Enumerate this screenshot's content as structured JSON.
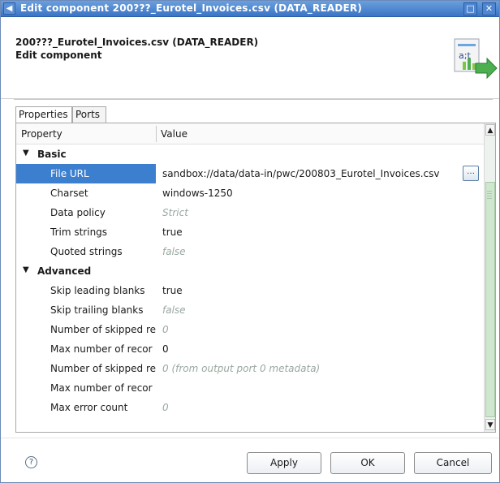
{
  "window": {
    "title": "Edit component 200???_Eurotel_Invoices.csv (DATA_READER)",
    "app_icon": "eclipse-back-icon",
    "maximize_icon": "maximize-icon",
    "close_icon": "close-icon"
  },
  "header": {
    "component_name": "200???_Eurotel_Invoices.csv (DATA_READER)",
    "subtitle": "Edit component",
    "icon": "data-reader-icon"
  },
  "tabs": [
    {
      "label": "Properties",
      "active": true
    },
    {
      "label": "Ports",
      "active": false
    }
  ],
  "table": {
    "col_property": "Property",
    "col_value": "Value",
    "rows": [
      {
        "kind": "category",
        "label": "Basic"
      },
      {
        "kind": "property",
        "label": "File URL",
        "value": "sandbox://data/data-in/pwc/200803_Eurotel_Invoices.csv",
        "selected": true,
        "muted": false
      },
      {
        "kind": "property",
        "label": "Charset",
        "value": "windows-1250",
        "muted": false
      },
      {
        "kind": "property",
        "label": "Data policy",
        "value": "Strict",
        "muted": true
      },
      {
        "kind": "property",
        "label": "Trim strings",
        "value": "true",
        "muted": false
      },
      {
        "kind": "property",
        "label": "Quoted strings",
        "value": "false",
        "muted": true
      },
      {
        "kind": "category",
        "label": "Advanced"
      },
      {
        "kind": "property",
        "label": "Skip leading blanks",
        "value": "true",
        "muted": false
      },
      {
        "kind": "property",
        "label": "Skip trailing blanks",
        "value": "false",
        "muted": true
      },
      {
        "kind": "property",
        "label": "Number of skipped re",
        "value": "0",
        "muted": true
      },
      {
        "kind": "property",
        "label": "Max number of recor",
        "value": "0",
        "muted": false
      },
      {
        "kind": "property",
        "label": "Number of skipped re",
        "value": "0 (from output port 0 metadata)",
        "muted": true
      },
      {
        "kind": "property",
        "label": "Max number of recor",
        "value": "",
        "muted": false
      },
      {
        "kind": "property",
        "label": "Max error count",
        "value": "0",
        "muted": true
      }
    ]
  },
  "buttons": {
    "apply": "Apply",
    "ok": "OK",
    "cancel": "Cancel",
    "help_icon": "help-icon"
  },
  "colors": {
    "titlebar": "#3b74c4",
    "selection": "#3d7fcf",
    "scroll_thumb": "#cfe6cf"
  }
}
